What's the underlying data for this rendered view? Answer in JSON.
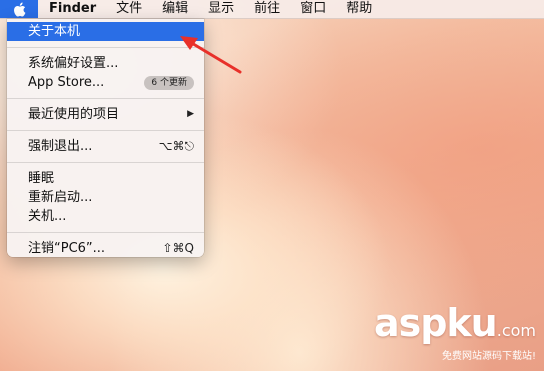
{
  "menubar": {
    "apple_icon": "apple-logo-icon",
    "items": [
      "Finder",
      "文件",
      "编辑",
      "显示",
      "前往",
      "窗口",
      "帮助"
    ]
  },
  "apple_menu": {
    "about": "关于本机",
    "system_prefs": "系统偏好设置...",
    "app_store": "App Store...",
    "app_store_badge": "6 个更新",
    "recent_items": "最近使用的项目",
    "force_quit": "强制退出...",
    "force_quit_shortcut": "⌥⌘⎋",
    "sleep": "睡眠",
    "restart": "重新启动...",
    "shutdown": "关机...",
    "logout": "注销“PC6”...",
    "logout_shortcut": "⇧⌘Q"
  },
  "watermark": {
    "brand": "aspku",
    "suffix": ".com",
    "tagline": "免费网站源码下载站!"
  },
  "colors": {
    "highlight": "#2a6ee6",
    "arrow": "#e8302a"
  }
}
